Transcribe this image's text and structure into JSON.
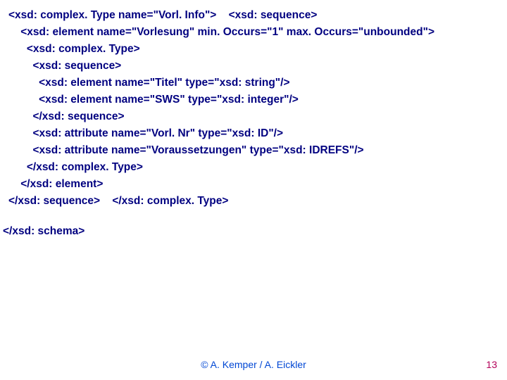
{
  "code": {
    "l1": "<xsd: complex. Type name=\"Vorl. Info\">    <xsd: sequence>",
    "l2": "    <xsd: element name=\"Vorlesung\" min. Occurs=\"1\" max. Occurs=\"unbounded\">",
    "l3": "      <xsd: complex. Type>",
    "l4": "        <xsd: sequence>",
    "l5": "          <xsd: element name=\"Titel\" type=\"xsd: string\"/>",
    "l6": "          <xsd: element name=\"SWS\" type=\"xsd: integer\"/>",
    "l7": "        </xsd: sequence>",
    "l8": "        <xsd: attribute name=\"Vorl. Nr\" type=\"xsd: ID\"/>",
    "l9": "        <xsd: attribute name=\"Voraussetzungen\" type=\"xsd: IDREFS\"/>",
    "l10": "      </xsd: complex. Type>",
    "l11": "    </xsd: element>",
    "l12": "</xsd: sequence>    </xsd: complex. Type>"
  },
  "schema_end": "</xsd: schema>",
  "footer": {
    "center": "© A. Kemper / A. Eickler",
    "page": "13"
  }
}
